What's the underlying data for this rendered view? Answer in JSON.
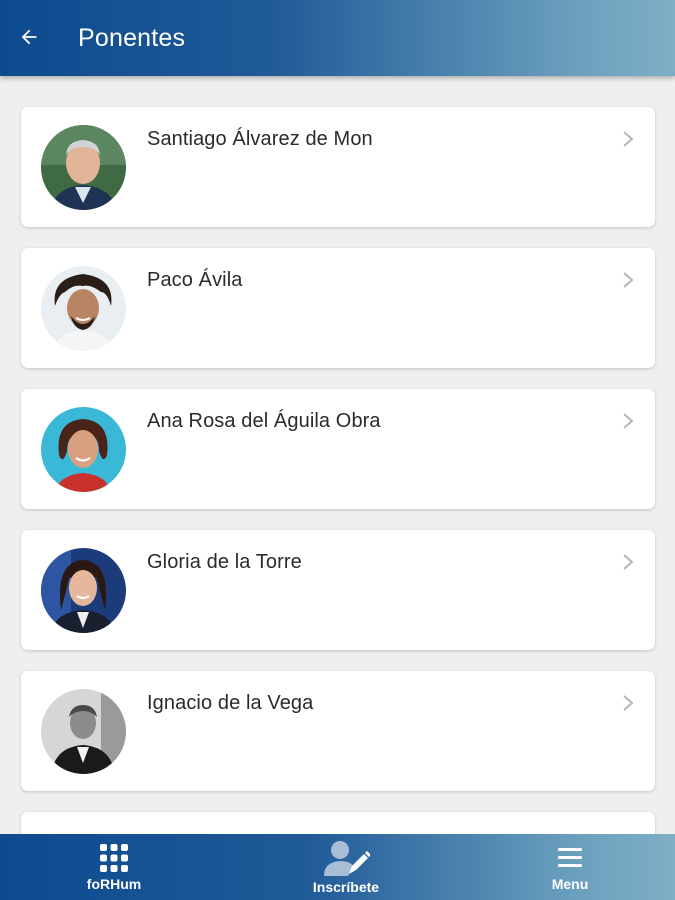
{
  "header": {
    "title": "Ponentes",
    "back_icon": "arrow-left-icon"
  },
  "speakers": [
    {
      "name": "Santiago Álvarez de Mon"
    },
    {
      "name": "Paco Ávila"
    },
    {
      "name": "Ana Rosa del Águila Obra"
    },
    {
      "name": "Gloria de la Torre"
    },
    {
      "name": "Ignacio de la Vega"
    }
  ],
  "bottom_nav": {
    "items": [
      {
        "label": "foRHum",
        "icon": "grid-icon"
      },
      {
        "label": "Inscríbete",
        "icon": "user-edit-icon"
      },
      {
        "label": "Menu",
        "icon": "hamburger-icon"
      }
    ]
  },
  "colors": {
    "bar_start": "#0d4a8f",
    "bar_end": "#7eafc6",
    "background": "#efefef",
    "card": "#ffffff",
    "text": "#2b2b2b"
  }
}
